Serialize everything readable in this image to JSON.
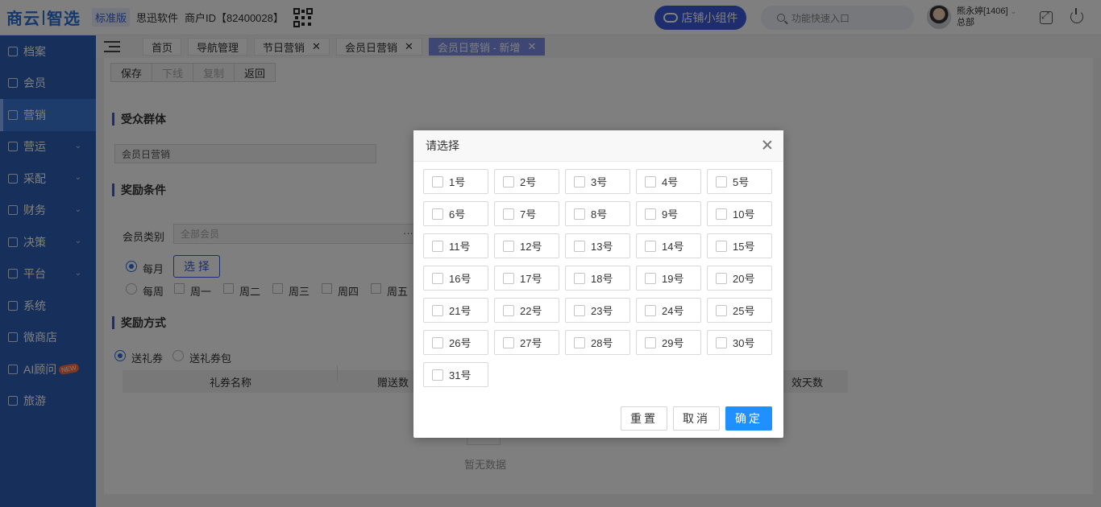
{
  "header": {
    "logo_part1": "商云",
    "logo_part2": "智选",
    "edition": "标准版",
    "company": "思迅软件",
    "merchant": "商户ID【82400028】",
    "widget_button": "店铺小组件",
    "search_placeholder": "功能快速入口",
    "user_name": "熊永婷[1406]",
    "user_dept": "总部"
  },
  "sidebar": {
    "items": [
      {
        "label": "档案",
        "icon": "archive-icon",
        "chevron": false,
        "active": false
      },
      {
        "label": "会员",
        "icon": "user-icon",
        "chevron": false,
        "active": false
      },
      {
        "label": "营销",
        "icon": "store-icon",
        "chevron": false,
        "active": true
      },
      {
        "label": "营运",
        "icon": "store-icon",
        "chevron": true,
        "active": false
      },
      {
        "label": "采配",
        "icon": "purchase-icon",
        "chevron": true,
        "active": false
      },
      {
        "label": "财务",
        "icon": "finance-icon",
        "chevron": true,
        "active": false
      },
      {
        "label": "决策",
        "icon": "decision-icon",
        "chevron": true,
        "active": false
      },
      {
        "label": "平台",
        "icon": "monitor-icon",
        "chevron": true,
        "active": false
      },
      {
        "label": "系统",
        "icon": "settings-icon",
        "chevron": false,
        "active": false
      },
      {
        "label": "微商店",
        "icon": "shop-icon",
        "chevron": false,
        "active": false
      },
      {
        "label": "AI顾问",
        "icon": "ai-icon",
        "chevron": false,
        "active": false,
        "badge": "NEW"
      },
      {
        "label": "旅游",
        "icon": "travel-icon",
        "chevron": false,
        "active": false
      }
    ]
  },
  "tabs": [
    {
      "label": "首页",
      "closable": false,
      "active": false
    },
    {
      "label": "导航管理",
      "closable": false,
      "active": false
    },
    {
      "label": "节日营销",
      "closable": true,
      "active": false
    },
    {
      "label": "会员日营销",
      "closable": true,
      "active": false
    },
    {
      "label": "会员日营销 - 新增",
      "closable": true,
      "active": true
    }
  ],
  "toolbar": {
    "save": "保存",
    "offline": "下线",
    "copy": "复制",
    "back": "返回"
  },
  "form": {
    "audience_title": "受众群体",
    "audience_value": "会员日营销",
    "reward_condition_title": "奖励条件",
    "member_type_label": "会员类别",
    "member_type_value": "全部会员",
    "member_type_more": "···",
    "monthly_label": "每月",
    "select_button": "选 择",
    "weekly_label": "每周",
    "weekdays": [
      "周一",
      "周二",
      "周三",
      "周四",
      "周五"
    ],
    "reward_method_title": "奖励方式",
    "gift_coupon": "送礼券",
    "gift_coupon_pack": "送礼券包",
    "table_headers": [
      "礼券名称",
      "赠送数",
      "效天数"
    ],
    "empty_text": "暂无数据"
  },
  "modal": {
    "title": "请选择",
    "days": [
      "1号",
      "2号",
      "3号",
      "4号",
      "5号",
      "6号",
      "7号",
      "8号",
      "9号",
      "10号",
      "11号",
      "12号",
      "13号",
      "14号",
      "15号",
      "16号",
      "17号",
      "18号",
      "19号",
      "20号",
      "21号",
      "22号",
      "23号",
      "24号",
      "25号",
      "26号",
      "27号",
      "28号",
      "29号",
      "30号",
      "31号"
    ],
    "reset": "重置",
    "cancel": "取消",
    "confirm": "确定"
  },
  "colors": {
    "sidebar_bg": "#2c5fb6",
    "accent": "#3b5bdb",
    "confirm": "#1e90ff"
  }
}
